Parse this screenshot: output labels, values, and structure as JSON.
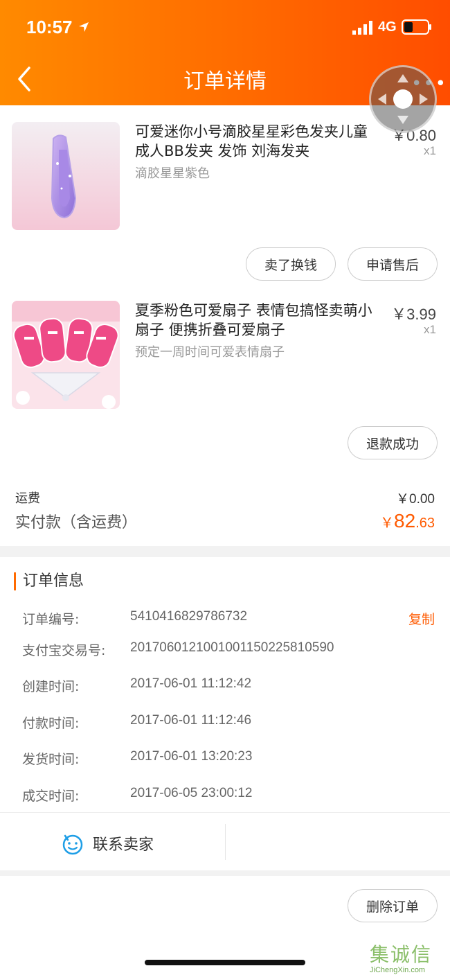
{
  "status_bar": {
    "time": "10:57",
    "network": "4G"
  },
  "header": {
    "title": "订单详情"
  },
  "items": [
    {
      "name": "可爱迷你小号滴胶星星彩色发夹儿童成人BB发夹 发饰 刘海发夹",
      "spec": "滴胶星星紫色",
      "price": "￥0.80",
      "qty": "x1",
      "actions": [
        "卖了换钱",
        "申请售后"
      ]
    },
    {
      "name": "夏季粉色可爱扇子 表情包搞怪卖萌小扇子 便携折叠可爱扇子",
      "spec": "预定一周时间可爱表情扇子",
      "price": "￥3.99",
      "qty": "x1",
      "actions": [
        "退款成功"
      ]
    }
  ],
  "summary": {
    "shipping_label": "运费",
    "shipping_value": "￥0.00",
    "paid_label": "实付款（含运费）",
    "paid_currency": "￥",
    "paid_int": "82",
    "paid_dec": ".63"
  },
  "order_info": {
    "title": "订单信息",
    "copy_label": "复制",
    "rows": [
      {
        "label": "订单编号:",
        "value": "5410416829786732"
      },
      {
        "label": "支付宝交易号:",
        "value": "2017060121001001150225810590"
      },
      {
        "label": "创建时间:",
        "value": "2017-06-01 11:12:42"
      },
      {
        "label": "付款时间:",
        "value": "2017-06-01 11:12:46"
      },
      {
        "label": "发货时间:",
        "value": "2017-06-01 13:20:23"
      },
      {
        "label": "成交时间:",
        "value": "2017-06-05 23:00:12"
      }
    ]
  },
  "contact": {
    "label": "联系卖家"
  },
  "footer": {
    "delete_label": "删除订单"
  },
  "watermark": {
    "main": "集诚信",
    "sub": "JiChengXin.com"
  },
  "colors": {
    "header_start": "#ff8a00",
    "header_end": "#ff4d00",
    "accent": "#ff5a00"
  }
}
